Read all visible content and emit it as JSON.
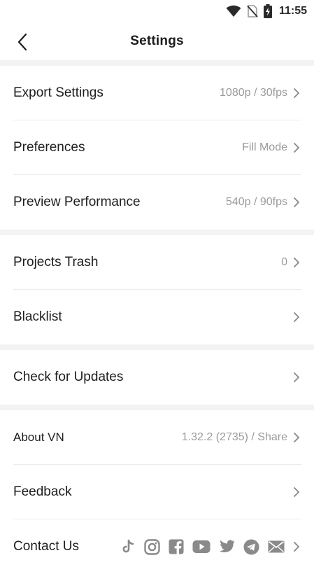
{
  "status_bar": {
    "time": "11:55"
  },
  "header": {
    "title": "Settings"
  },
  "sections": [
    [
      {
        "key": "export",
        "label": "Export Settings",
        "value": "1080p / 30fps"
      },
      {
        "key": "preferences",
        "label": "Preferences",
        "value": "Fill Mode"
      },
      {
        "key": "preview",
        "label": "Preview Performance",
        "value": "540p / 90fps"
      }
    ],
    [
      {
        "key": "trash",
        "label": "Projects Trash",
        "value": "0"
      },
      {
        "key": "blacklist",
        "label": "Blacklist",
        "value": ""
      }
    ],
    [
      {
        "key": "updates",
        "label": "Check for Updates",
        "value": ""
      }
    ],
    [
      {
        "key": "about",
        "label": "About VN",
        "value": "1.32.2 (2735) / Share"
      },
      {
        "key": "feedback",
        "label": "Feedback",
        "value": ""
      },
      {
        "key": "contact",
        "label": "Contact Us",
        "value": ""
      }
    ]
  ],
  "contact_icons": [
    "tiktok-icon",
    "instagram-icon",
    "facebook-icon",
    "youtube-icon",
    "twitter-icon",
    "telegram-icon",
    "mail-icon"
  ],
  "colors": {
    "icon_gray": "#8a8a8a",
    "section_gap": "#f3f3f3",
    "value_text": "#9b9b9b"
  }
}
